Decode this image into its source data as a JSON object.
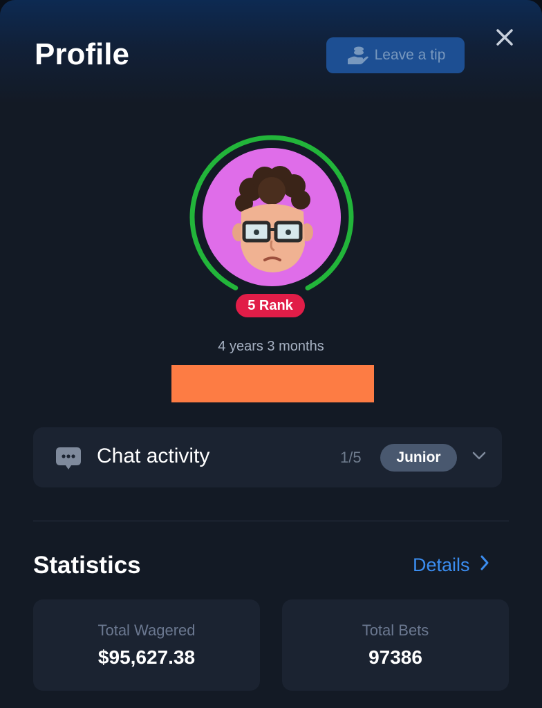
{
  "header": {
    "title": "Profile",
    "tip_button_label": "Leave a tip"
  },
  "profile": {
    "rank_label": "5 Rank",
    "membership_duration": "4 years 3 months",
    "level_progress": 0.85,
    "colors": {
      "ring": "#22b53a",
      "avatar_bg": "#df6de9",
      "rank_badge": "#e11d48"
    }
  },
  "chat_activity": {
    "label": "Chat activity",
    "count": "1/5",
    "level": "Junior"
  },
  "statistics": {
    "title": "Statistics",
    "details_label": "Details",
    "cards": [
      {
        "label": "Total Wagered",
        "value": "$95,627.38"
      },
      {
        "label": "Total Bets",
        "value": "97386"
      }
    ]
  },
  "icons": [
    "coin-hand-icon",
    "close-icon",
    "chat-bubble-icon",
    "chevron-down-icon",
    "chevron-right-icon"
  ]
}
